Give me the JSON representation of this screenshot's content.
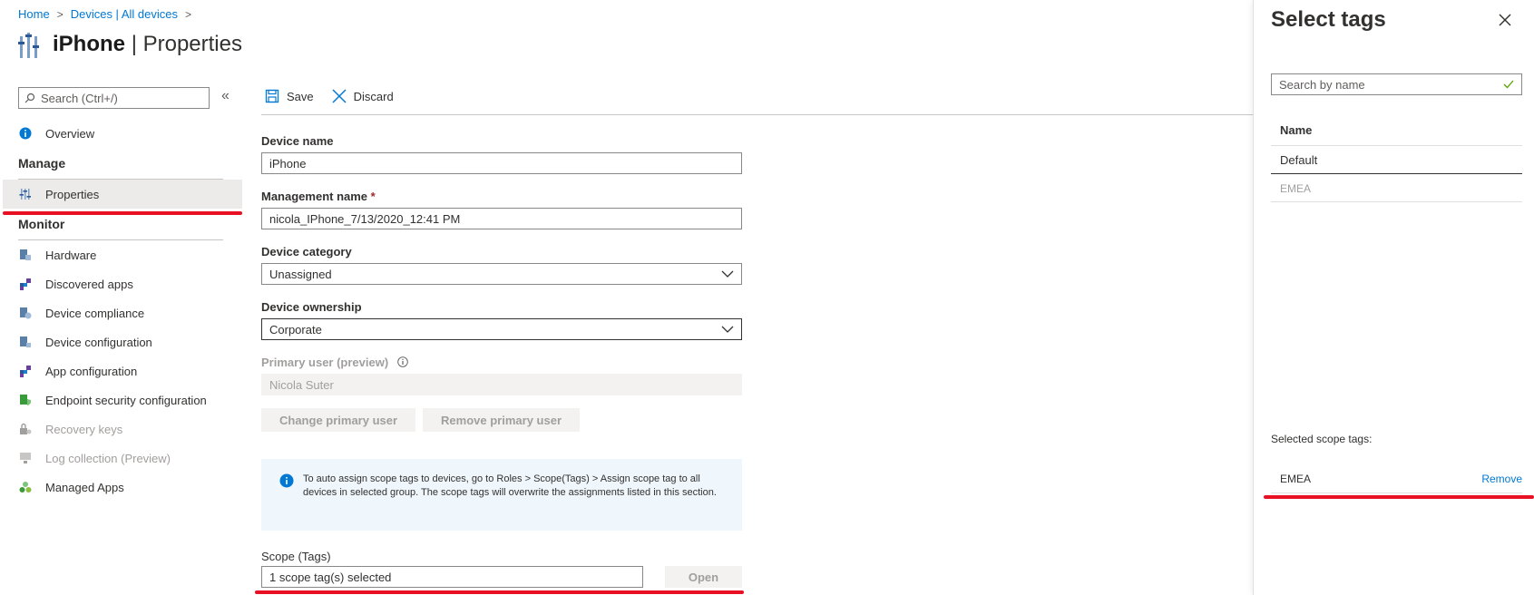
{
  "breadcrumb": {
    "home": "Home",
    "devices": "Devices | All devices"
  },
  "page": {
    "name": "iPhone",
    "section": "Properties"
  },
  "sidebar": {
    "search_placeholder": "Search (Ctrl+/)",
    "overview": "Overview",
    "manage_header": "Manage",
    "properties": "Properties",
    "monitor_header": "Monitor",
    "items": [
      {
        "label": "Hardware",
        "icon": "hardware-icon"
      },
      {
        "label": "Discovered apps",
        "icon": "apps-icon"
      },
      {
        "label": "Device compliance",
        "icon": "compliance-icon"
      },
      {
        "label": "Device configuration",
        "icon": "configuration-icon"
      },
      {
        "label": "App configuration",
        "icon": "app-config-icon"
      },
      {
        "label": "Endpoint security configuration",
        "icon": "endpoint-security-icon"
      },
      {
        "label": "Recovery keys",
        "icon": "key-icon",
        "disabled": true
      },
      {
        "label": "Log collection (Preview)",
        "icon": "log-icon",
        "disabled": true
      },
      {
        "label": "Managed Apps",
        "icon": "managed-apps-icon"
      }
    ]
  },
  "toolbar": {
    "save": "Save",
    "discard": "Discard"
  },
  "form": {
    "device_name_label": "Device name",
    "device_name_value": "iPhone",
    "management_name_label": "Management name",
    "required_mark": "*",
    "management_name_value": "nicola_IPhone_7/13/2020_12:41 PM",
    "device_category_label": "Device category",
    "device_category_value": "Unassigned",
    "device_ownership_label": "Device ownership",
    "device_ownership_value": "Corporate",
    "primary_user_label": "Primary user (preview)",
    "primary_user_value": "Nicola Suter",
    "change_primary_user": "Change primary user",
    "remove_primary_user": "Remove primary user",
    "info_text": "To auto assign scope tags to devices, go to Roles > Scope(Tags) > Assign scope tag to all devices in selected group. The scope tags will overwrite the assignments listed in this section.",
    "scope_label": "Scope (Tags)",
    "scope_value": "1 scope tag(s) selected",
    "open_button": "Open"
  },
  "panel": {
    "title": "Select tags",
    "search_placeholder": "Search by name",
    "column_name": "Name",
    "rows": [
      "Default",
      "EMEA"
    ],
    "selected_label": "Selected scope tags:",
    "selected_tag": "EMEA",
    "remove_label": "Remove"
  },
  "colors": {
    "accent": "#0078d4",
    "highlight": "#e81123",
    "info_bg": "#eff6fc"
  }
}
